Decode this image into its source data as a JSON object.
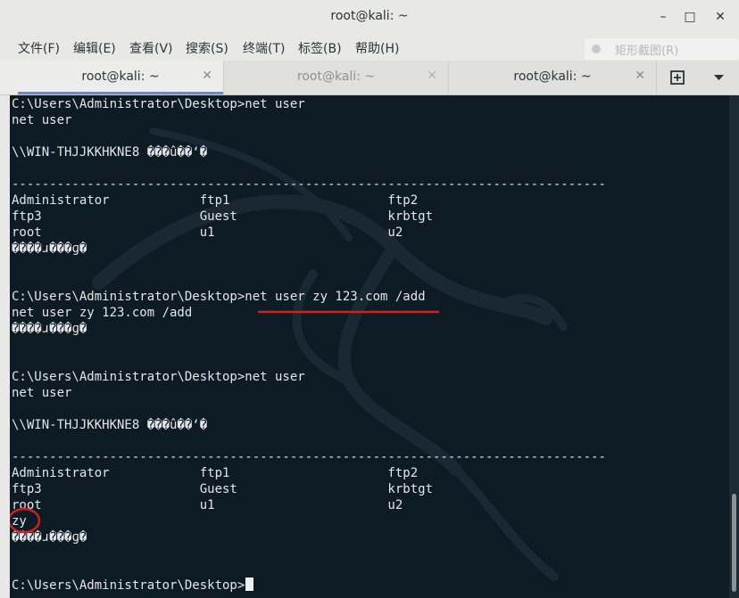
{
  "window": {
    "title": "root@kali: ~",
    "minimize": "–",
    "maximize": "□",
    "close": "✕"
  },
  "menu": {
    "items": [
      "文件(F)",
      "编辑(E)",
      "查看(V)",
      "搜索(S)",
      "终端(T)",
      "标签(B)",
      "帮助(H)"
    ]
  },
  "overlay": {
    "screenshot_tool_label": "矩形截图(R)"
  },
  "tabs": [
    {
      "label": "root@kali: ~",
      "active": true
    },
    {
      "label": "root@kali: ~",
      "active": false
    },
    {
      "label": "root@kali: ~",
      "active": false
    }
  ],
  "tab_close": "✕",
  "tab_actions": {
    "new_tab_icon": "new-tab-icon",
    "menu_icon": "chevron-down-icon"
  },
  "terminal": {
    "lines": [
      "C:\\Users\\Administrator\\Desktop>net user",
      "net user",
      "",
      "\\\\WIN-THJJKKHKNE8 ���û��ʻ�",
      "",
      "-------------------------------------------------------------------------------",
      "Administrator            ftp1                     ftp2",
      "ftp3                     Guest                    krbtgt",
      "root                     u1                       u2",
      "����ɹ���ɡ�",
      "",
      "",
      "C:\\Users\\Administrator\\Desktop>net user zy 123.com /add",
      "net user zy 123.com /add",
      "����ɹ���ɡ�",
      "",
      "",
      "C:\\Users\\Administrator\\Desktop>net user",
      "net user",
      "",
      "\\\\WIN-THJJKKHKNE8 ���û��ʻ�",
      "",
      "-------------------------------------------------------------------------------",
      "Administrator            ftp1                     ftp2",
      "ftp3                     Guest                    krbtgt",
      "root                     u1                       u2",
      "zy",
      "����ɹ���ɡ�",
      "",
      "",
      "C:\\Users\\Administrator\\Desktop>"
    ]
  }
}
